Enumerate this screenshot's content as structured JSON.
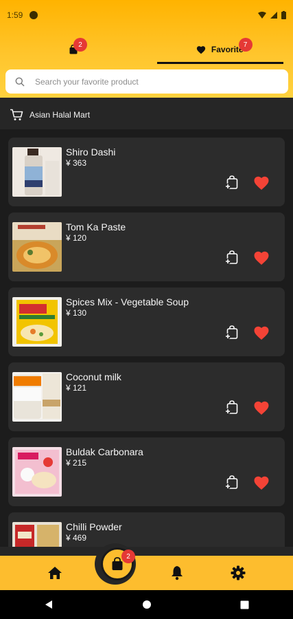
{
  "status_bar": {
    "time": "1:59"
  },
  "tabs": {
    "cart_badge": "2",
    "favorite_label": "Favorite",
    "favorite_badge": "7"
  },
  "search": {
    "placeholder": "Search your favorite product"
  },
  "store": {
    "name": "Asian Halal Mart"
  },
  "products": [
    {
      "name": "Shiro Dashi",
      "price": "¥ 363"
    },
    {
      "name": "Tom Ka Paste",
      "price": "¥ 120"
    },
    {
      "name": "Spices Mix - Vegetable Soup",
      "price": "¥ 130"
    },
    {
      "name": "Coconut milk",
      "price": "¥ 121"
    },
    {
      "name": "Buldak Carbonara",
      "price": "¥ 215"
    },
    {
      "name": "Chilli Powder",
      "price": "¥ 469"
    }
  ],
  "bottom_nav": {
    "cart_badge": "2"
  },
  "colors": {
    "accent": "#fdbd2e",
    "favorite": "#f44336",
    "background": "#262626",
    "card": "#2c2c2c"
  }
}
